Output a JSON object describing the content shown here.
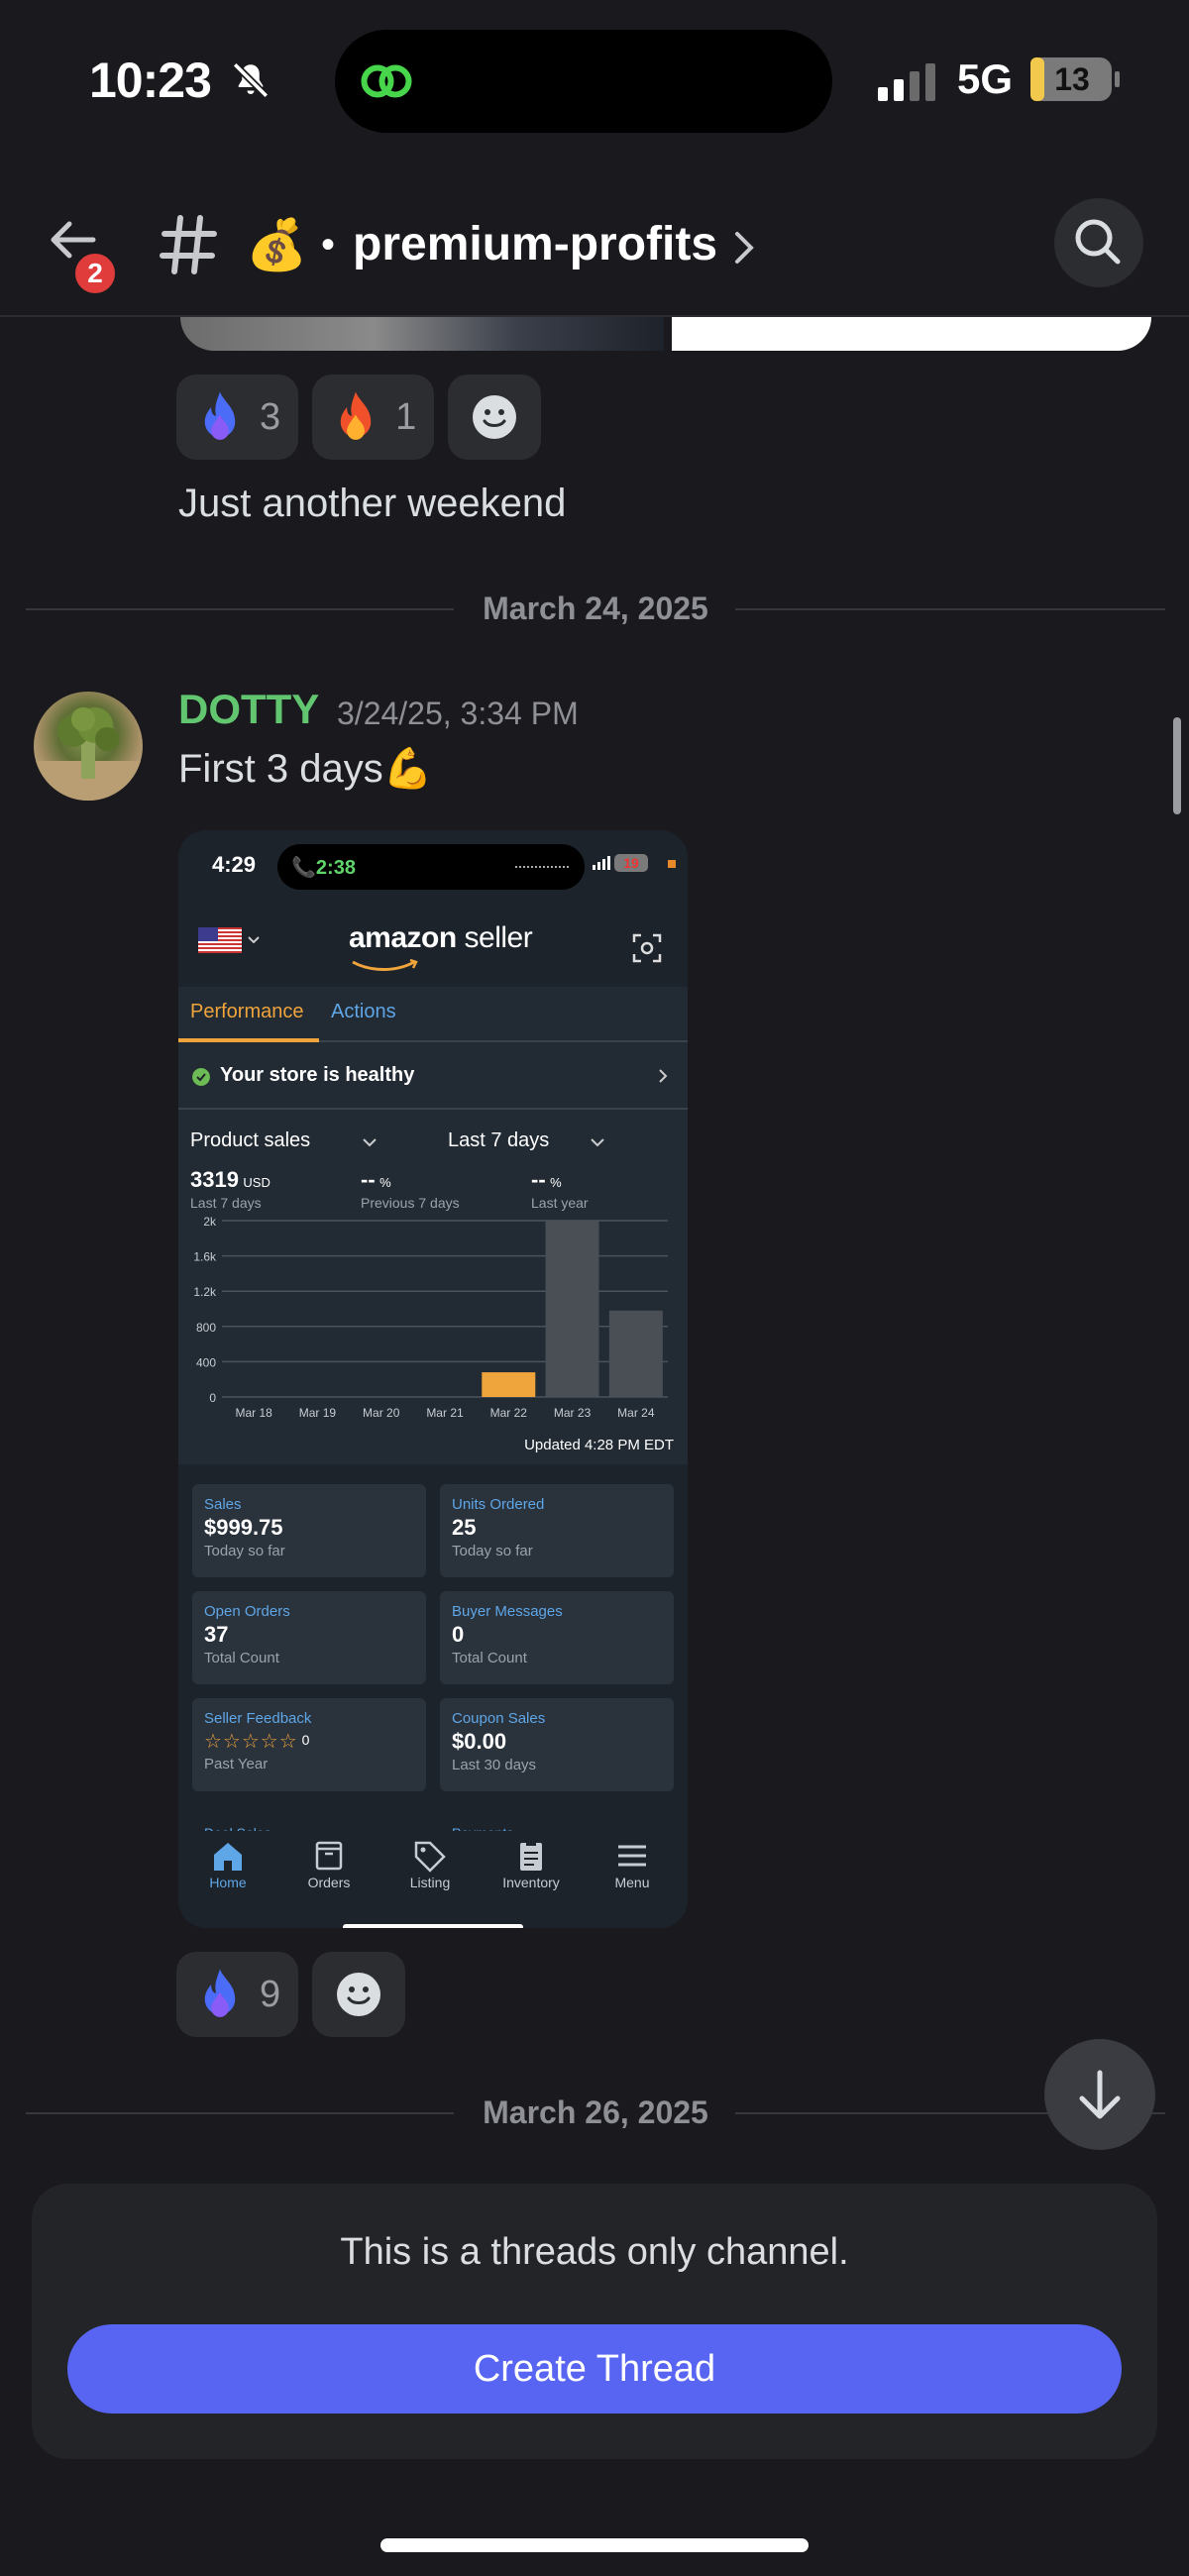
{
  "status_bar": {
    "time": "10:23",
    "network": "5G",
    "battery": "13"
  },
  "header": {
    "back_badge": "2",
    "channel_emoji": "💰",
    "separator": "•",
    "channel_name": "premium-profits"
  },
  "messages": {
    "prev_reactions": [
      {
        "emoji": "blue-fire-icon",
        "count": "3"
      },
      {
        "emoji": "fire-icon",
        "count": "1"
      }
    ],
    "prev_text": "Just another weekend",
    "date_1": "March 24, 2025",
    "author": "DOTTY",
    "author_color": "#61c66f",
    "timestamp": "3/24/25, 3:34 PM",
    "text": "First 3 days💪",
    "reactions": [
      {
        "emoji": "blue-fire-icon",
        "count": "9"
      }
    ],
    "date_2": "March 26, 2025"
  },
  "screenshot": {
    "time": "4:29",
    "call_time": "2:38",
    "battery": "19",
    "logo_brand": "amazon",
    "logo_rest": " seller",
    "tabs": {
      "active": "Performance",
      "inactive": "Actions"
    },
    "health": "Your store is healthy",
    "filter_metric": "Product sales",
    "filter_period": "Last 7 days",
    "kpis": [
      {
        "value": "3319",
        "unit": "USD",
        "sub": "Last 7 days"
      },
      {
        "value": "--",
        "unit": "%",
        "sub": "Previous 7 days"
      },
      {
        "value": "--",
        "unit": "%",
        "sub": "Last year"
      }
    ],
    "updated": "Updated 4:28 PM EDT",
    "cards": [
      {
        "title": "Sales",
        "value": "$999.75",
        "sub": "Today so far"
      },
      {
        "title": "Units Ordered",
        "value": "25",
        "sub": "Today so far"
      },
      {
        "title": "Open Orders",
        "value": "37",
        "sub": "Total Count"
      },
      {
        "title": "Buyer Messages",
        "value": "0",
        "sub": "Total Count"
      },
      {
        "title": "Seller Feedback",
        "stars": "☆☆☆☆☆",
        "value": "0",
        "sub": "Past Year"
      },
      {
        "title": "Coupon Sales",
        "value": "$0.00",
        "sub": "Last 30 days"
      }
    ],
    "peek_cards": [
      "Deal Sales",
      "Payments"
    ],
    "nav": [
      "Home",
      "Orders",
      "Listing",
      "Inventory",
      "Menu"
    ],
    "accent": "#f0a43c",
    "link": "#5fa6e6"
  },
  "chart_data": {
    "type": "bar",
    "categories": [
      "Mar 18",
      "Mar 19",
      "Mar 20",
      "Mar 21",
      "Mar 22",
      "Mar 23",
      "Mar 24"
    ],
    "values": [
      0,
      0,
      0,
      0,
      280,
      2000,
      980
    ],
    "colors": [
      "#4a4f55",
      "#4a4f55",
      "#4a4f55",
      "#4a4f55",
      "#f0a43c",
      "#4a4f55",
      "#4a4f55"
    ],
    "ytick_labels": [
      "0",
      "400",
      "800",
      "1.2k",
      "1.6k",
      "2k"
    ],
    "ylim": [
      0,
      2000
    ],
    "grid": true
  },
  "threads_panel": {
    "text": "This is a threads only channel.",
    "button": "Create Thread",
    "button_color": "#5865f2"
  }
}
